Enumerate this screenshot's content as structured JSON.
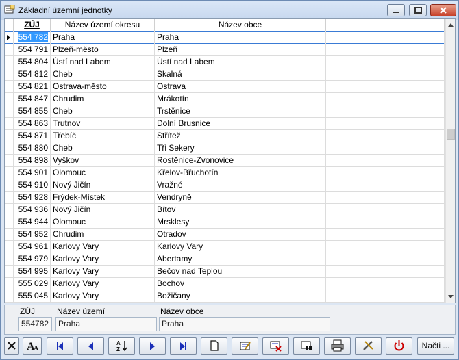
{
  "window": {
    "title": "Základní územní jednotky"
  },
  "grid": {
    "columns": [
      "ZÚJ",
      "Název území okresu",
      "Název obce"
    ],
    "rows": [
      [
        "554 782",
        "Praha",
        "Praha"
      ],
      [
        "554 791",
        "Plzeň-město",
        "Plzeň"
      ],
      [
        "554 804",
        "Ústí nad Labem",
        "Ústí nad Labem"
      ],
      [
        "554 812",
        "Cheb",
        "Skalná"
      ],
      [
        "554 821",
        "Ostrava-město",
        "Ostrava"
      ],
      [
        "554 847",
        "Chrudim",
        "Mrákotín"
      ],
      [
        "554 855",
        "Cheb",
        "Trstěnice"
      ],
      [
        "554 863",
        "Trutnov",
        "Dolní Brusnice"
      ],
      [
        "554 871",
        "Třebíč",
        "Střítež"
      ],
      [
        "554 880",
        "Cheb",
        "Tři Sekery"
      ],
      [
        "554 898",
        "Vyškov",
        "Rostěnice-Zvonovice"
      ],
      [
        "554 901",
        "Olomouc",
        "Křelov-Břuchotín"
      ],
      [
        "554 910",
        "Nový Jičín",
        "Vražné"
      ],
      [
        "554 928",
        "Frýdek-Místek",
        "Vendryně"
      ],
      [
        "554 936",
        "Nový Jičín",
        "Bítov"
      ],
      [
        "554 944",
        "Olomouc",
        "Mrsklesy"
      ],
      [
        "554 952",
        "Chrudim",
        "Otradov"
      ],
      [
        "554 961",
        "Karlovy Vary",
        "Karlovy Vary"
      ],
      [
        "554 979",
        "Karlovy Vary",
        "Abertamy"
      ],
      [
        "554 995",
        "Karlovy Vary",
        "Bečov nad Teplou"
      ],
      [
        "555 029",
        "Karlovy Vary",
        "Bochov"
      ],
      [
        "555 045",
        "Karlovy Vary",
        "Božičany"
      ]
    ]
  },
  "detail": {
    "zuj_label": "ZÚJ",
    "zuj_value": "554782",
    "uzemi_label": "Název území",
    "uzemi_value": "Praha",
    "obec_label": "Název obce",
    "obec_value": "Praha"
  },
  "toolbar": {
    "sort_label": "A↓Z",
    "load_label": "Načti ...",
    "icons": [
      "close-icon",
      "font-icon",
      "first-record-icon",
      "prev-record-icon",
      "sort-icon",
      "next-record-icon",
      "last-record-icon",
      "new-document-icon",
      "edit-icon",
      "delete-icon",
      "find-icon",
      "print-icon",
      "tools-icon",
      "power-icon"
    ]
  },
  "colors": {
    "selection": "#3399ff",
    "power": "#cc0000",
    "nav": "#1a2fb8"
  }
}
